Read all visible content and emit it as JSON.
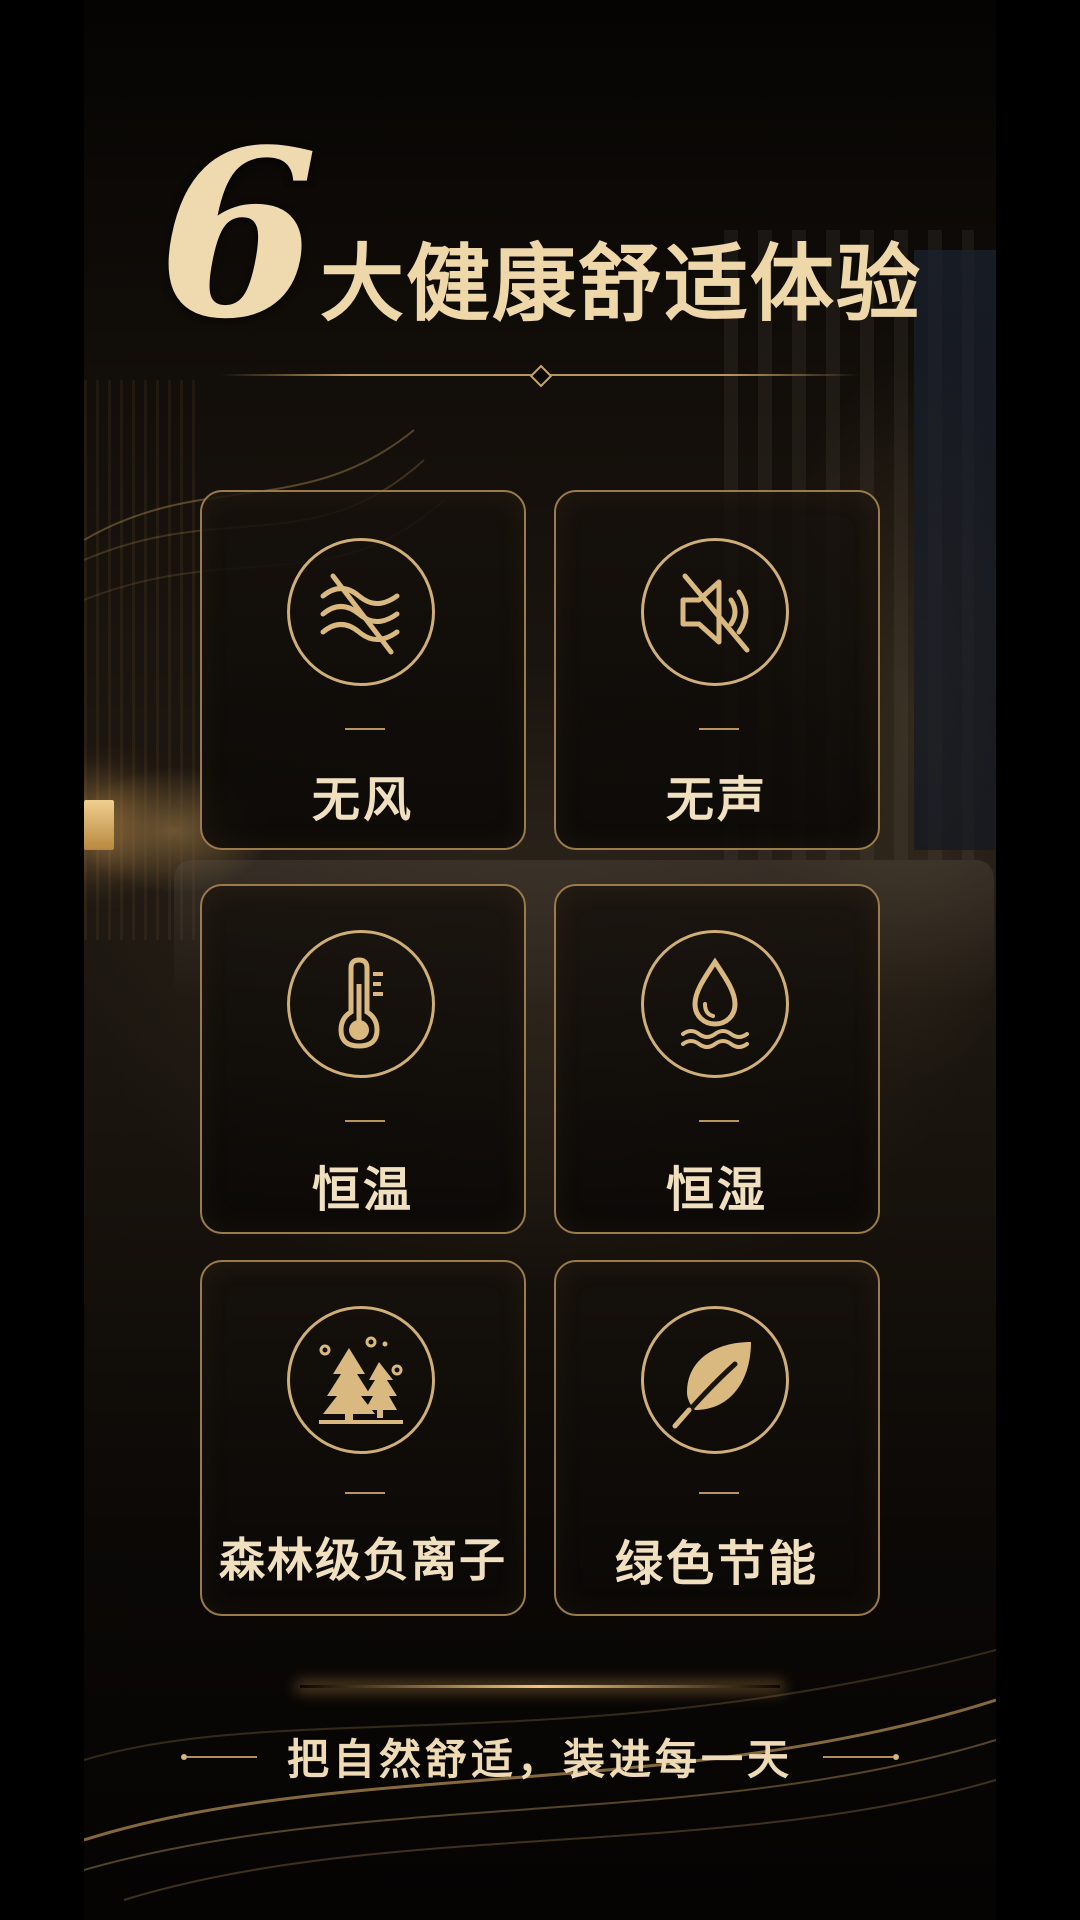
{
  "headline": {
    "number": "6",
    "title": "大健康舒适体验"
  },
  "features": [
    {
      "label": "无风",
      "icon": "no-wind-icon"
    },
    {
      "label": "无声",
      "icon": "mute-icon"
    },
    {
      "label": "恒温",
      "icon": "thermometer-icon"
    },
    {
      "label": "恒湿",
      "icon": "water-drop-icon"
    },
    {
      "label": "森林级负离子",
      "icon": "forest-icon"
    },
    {
      "label": "绿色节能",
      "icon": "leaf-icon"
    }
  ],
  "slogan": "把自然舒适，装进每一天",
  "colors": {
    "gold": "#cfae77",
    "text": "#f1e0c0",
    "background": "#000000"
  }
}
